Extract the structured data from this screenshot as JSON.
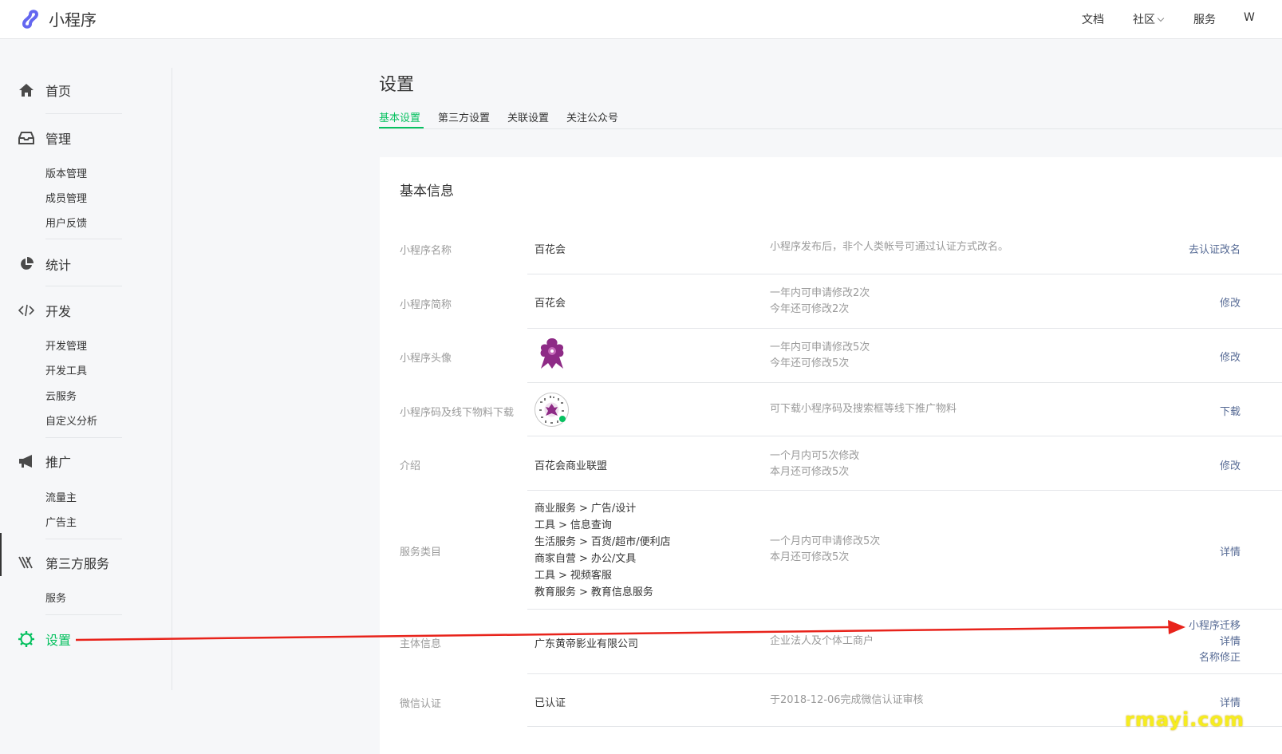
{
  "app": {
    "title": "小程序"
  },
  "topnav": {
    "docs": "文档",
    "community": "社区",
    "service": "服务",
    "cut": "W"
  },
  "sidebar": {
    "home": "首页",
    "manage": {
      "label": "管理",
      "items": [
        "版本管理",
        "成员管理",
        "用户反馈"
      ]
    },
    "stats": "统计",
    "dev": {
      "label": "开发",
      "items": [
        "开发管理",
        "开发工具",
        "云服务",
        "自定义分析"
      ]
    },
    "promo": {
      "label": "推广",
      "items": [
        "流量主",
        "广告主"
      ]
    },
    "third": {
      "label": "第三方服务",
      "items": [
        "服务"
      ]
    },
    "settings": "设置"
  },
  "page": {
    "title": "设置",
    "tabs": [
      "基本设置",
      "第三方设置",
      "关联设置",
      "关注公众号"
    ],
    "active_tab": "基本设置"
  },
  "card": {
    "title": "基本信息",
    "rows": [
      {
        "label": "小程序名称",
        "value": "百花会",
        "desc": [
          "小程序发布后，非个人类帐号可通过认证方式改名。"
        ],
        "action": "去认证改名"
      },
      {
        "label": "小程序简称",
        "value": "百花会",
        "desc": [
          "一年内可申请修改2次",
          "今年还可修改2次"
        ],
        "action": "修改"
      },
      {
        "label": "小程序头像",
        "value": "",
        "desc": [
          "一年内可申请修改5次",
          "今年还可修改5次"
        ],
        "action": "修改"
      },
      {
        "label": "小程序码及线下物料下载",
        "value": "",
        "desc": [
          "可下载小程序码及搜索框等线下推广物料"
        ],
        "action": "下载"
      },
      {
        "label": "介绍",
        "value": "百花会商业联盟",
        "desc": [
          "一个月内可5次修改",
          "本月还可修改5次"
        ],
        "action": "修改"
      },
      {
        "label": "服务类目",
        "categories": [
          [
            "商业服务",
            "广告/设计"
          ],
          [
            "工具",
            "信息查询"
          ],
          [
            "生活服务",
            "百货/超市/便利店"
          ],
          [
            "商家自营",
            "办公/文具"
          ],
          [
            "工具",
            "视频客服"
          ],
          [
            "教育服务",
            "教育信息服务"
          ]
        ],
        "desc": [
          "一个月内可申请修改5次",
          "本月还可修改5次"
        ],
        "action": "详情"
      },
      {
        "label": "主体信息",
        "value": "广东黄帝影业有限公司",
        "desc": [
          "企业法人及个体工商户"
        ],
        "actions": [
          "小程序迁移",
          "详情",
          "名称修正"
        ]
      },
      {
        "label": "微信认证",
        "value": "已认证",
        "desc": [
          "于2018-12-06完成微信认证审核"
        ],
        "action": "详情"
      }
    ]
  },
  "category_separator": ">",
  "watermark": "rmayi.com",
  "colors": {
    "accent": "#07c160",
    "link": "#576b95",
    "arrow": "#e8231b",
    "muted": "#9a9a9a"
  }
}
